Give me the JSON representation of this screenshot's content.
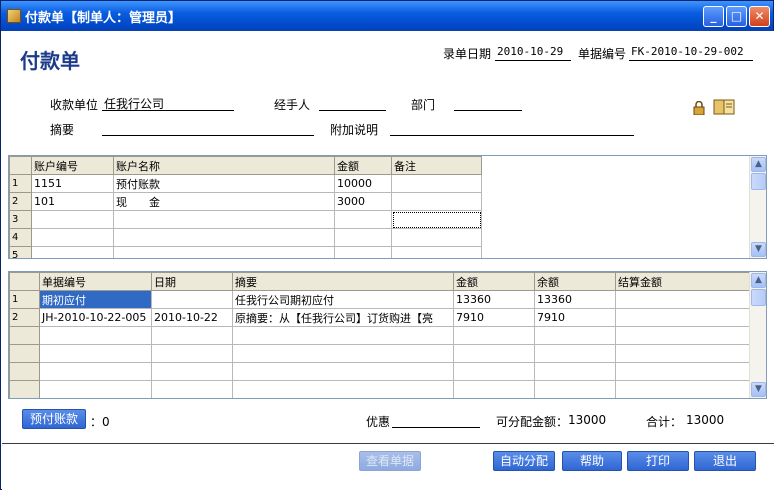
{
  "window": {
    "title": "付款单【制单人：管理员】"
  },
  "header": {
    "page_title": "付款单",
    "entry_date_label": "录单日期",
    "entry_date_value": "2010-10-29",
    "doc_no_label": "单据编号",
    "doc_no_value": "FK-2010-10-29-002"
  },
  "form": {
    "payee_label": "收款单位",
    "payee_value": "任我行公司",
    "handler_label": "经手人",
    "handler_value": "",
    "dept_label": "部门",
    "dept_value": "",
    "summary_label": "摘要",
    "summary_value": "",
    "note_label": "附加说明",
    "note_value": ""
  },
  "accounts_grid": {
    "columns": [
      "账户编号",
      "账户名称",
      "金额",
      "备注"
    ],
    "rows": [
      {
        "num": "1",
        "code": "1151",
        "name": "预付账款",
        "amount": "10000",
        "remark": ""
      },
      {
        "num": "2",
        "code": "101",
        "name": "现　　金",
        "amount": "3000",
        "remark": ""
      },
      {
        "num": "3",
        "code": "",
        "name": "",
        "amount": "",
        "remark": ""
      },
      {
        "num": "4",
        "code": "",
        "name": "",
        "amount": "",
        "remark": ""
      },
      {
        "num": "5",
        "code": "",
        "name": "",
        "amount": "",
        "remark": ""
      }
    ]
  },
  "bills_grid": {
    "columns": [
      "单据编号",
      "日期",
      "摘要",
      "金额",
      "余额",
      "结算金额"
    ],
    "rows": [
      {
        "num": "1",
        "doc": "期初应付",
        "date": "",
        "summary": "任我行公司期初应付",
        "amount": "13360",
        "balance": "13360",
        "settle": ""
      },
      {
        "num": "2",
        "doc": "JH-2010-10-22-005",
        "date": "2010-10-22",
        "summary": "原摘要：从【任我行公司】订货购进【亮",
        "amount": "7910",
        "balance": "7910",
        "settle": ""
      },
      {
        "num": "",
        "doc": "",
        "date": "",
        "summary": "",
        "amount": "",
        "balance": "",
        "settle": ""
      },
      {
        "num": "",
        "doc": "",
        "date": "",
        "summary": "",
        "amount": "",
        "balance": "",
        "settle": ""
      },
      {
        "num": "",
        "doc": "",
        "date": "",
        "summary": "",
        "amount": "",
        "balance": "",
        "settle": ""
      },
      {
        "num": "",
        "doc": "",
        "date": "",
        "summary": "",
        "amount": "",
        "balance": "",
        "settle": ""
      }
    ]
  },
  "footer": {
    "prepay_button": "预付账款",
    "prepay_value": "：0",
    "discount_label": "优惠",
    "discount_value": "",
    "allocatable_label": "可分配金额：",
    "allocatable_value": "13000",
    "total_label": "合计：",
    "total_value": "13000"
  },
  "actions": {
    "view_doc": "查看单据",
    "auto_allocate": "自动分配",
    "help": "帮助",
    "print": "打印",
    "exit": "退出"
  },
  "icons": {
    "lock": "lock-icon",
    "book": "book-icon"
  },
  "colors": {
    "title_blue": "#1b3b8a",
    "button_blue": "#2f66d3",
    "selection_blue": "#316ac5"
  }
}
